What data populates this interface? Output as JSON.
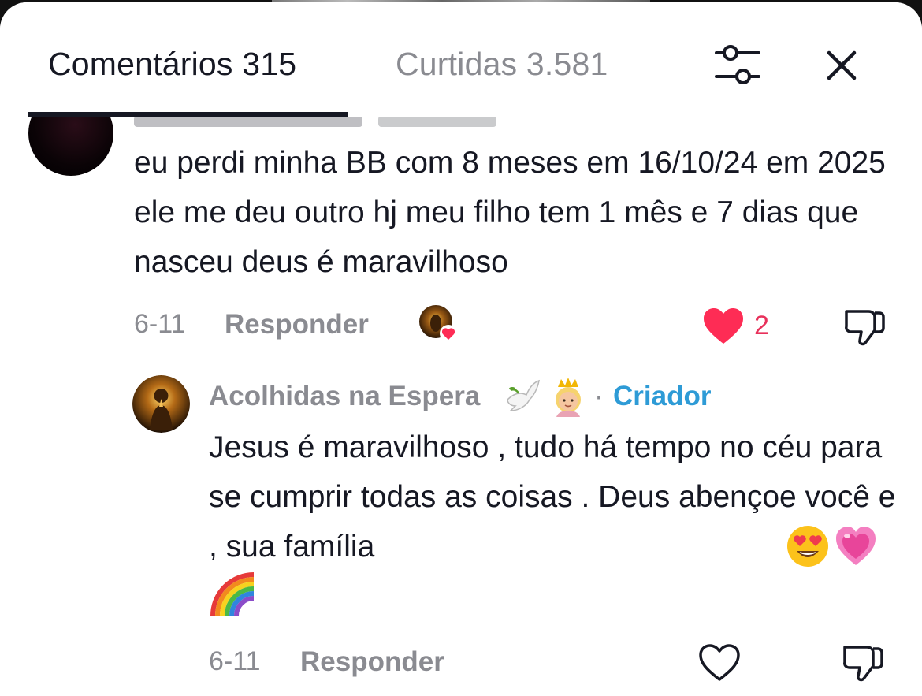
{
  "tabs": {
    "comments": "Comentários 315",
    "likes": "Curtidas 3.581"
  },
  "icons": {
    "filter": "sliders-icon",
    "close": "close-icon",
    "like": "heart-icon",
    "dislike": "thumbs-down-icon"
  },
  "colors": {
    "text": "#161823",
    "muted": "#8a8b91",
    "like_red": "#fe2c55",
    "creator_blue": "#2e9bd6"
  },
  "comment": {
    "text": "eu perdi minha BB com 8 meses em 16/10/24 em 2025 ele me deu outro hj meu filho tem 1 mês e 7 dias que nasceu deus é maravilhoso",
    "date": "6-11",
    "reply_label": "Responder",
    "likes": "2",
    "liked": true,
    "liked_by_creator": true
  },
  "reply": {
    "username": "Acolhidas na Espera",
    "username_emojis": [
      "dove-emoji",
      "princess-emoji"
    ],
    "separator": "·",
    "badge": "Criador",
    "text": "Jesus é maravilhoso , tudo há tempo no céu para se cumprir todas as coisas . Deus abençoe você e , sua família",
    "text_emojis": [
      "heart-eyes-emoji",
      "pink-heart-emoji",
      "rainbow-emoji"
    ],
    "date": "6-11",
    "reply_label": "Responder",
    "liked": false
  }
}
